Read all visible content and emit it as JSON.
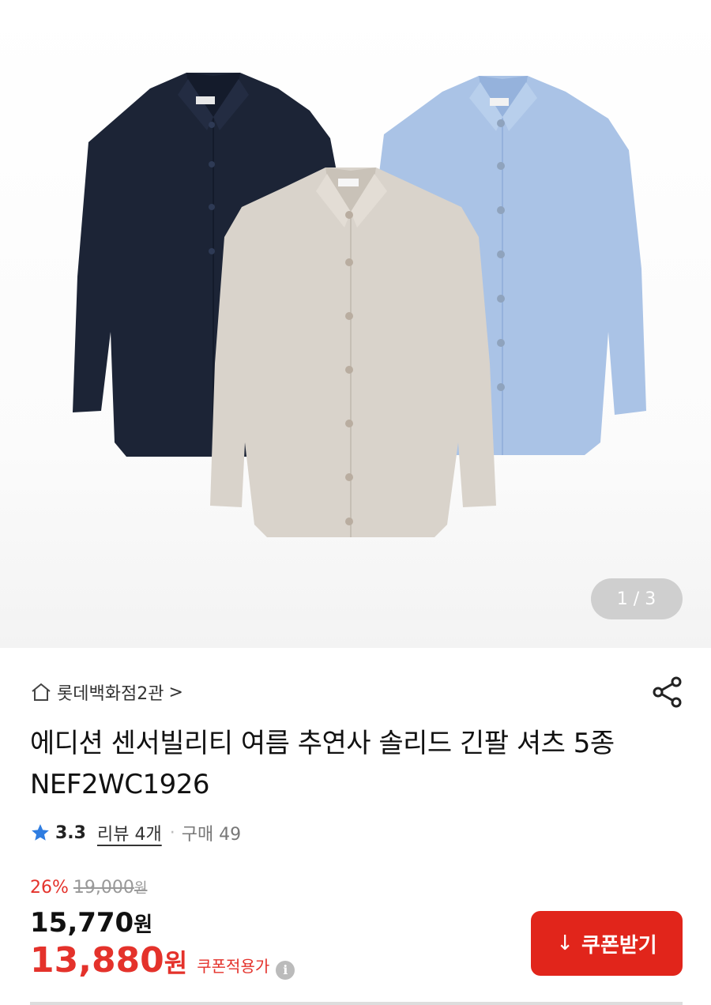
{
  "gallery": {
    "current": "1",
    "separator": "/",
    "total": "3",
    "shirts": [
      "navy-shirt",
      "beige-shirt",
      "light-blue-shirt"
    ]
  },
  "store": {
    "name": "롯데백화점2관",
    "chevron": ">"
  },
  "product": {
    "title": "에디션 센서빌리티 여름 추연사 솔리드 긴팔 셔츠 5종 NEF2WC1926"
  },
  "rating": {
    "score": "3.3",
    "reviews_label": "리뷰 4개",
    "dot": "·",
    "purchase_label": "구매 49"
  },
  "price": {
    "discount_rate": "26%",
    "original_value": "19,000",
    "original_unit": "원",
    "sale_value": "15,770",
    "sale_unit": "원",
    "coupon_value": "13,880",
    "coupon_unit": "원",
    "coupon_note": "쿠폰적용가",
    "info_glyph": "i"
  },
  "coupon_button": {
    "icon": "↓",
    "label": "쿠폰받기"
  },
  "colors": {
    "accent_red": "#e1251b",
    "price_red": "#e4322b",
    "star_blue": "#2f7de1"
  }
}
